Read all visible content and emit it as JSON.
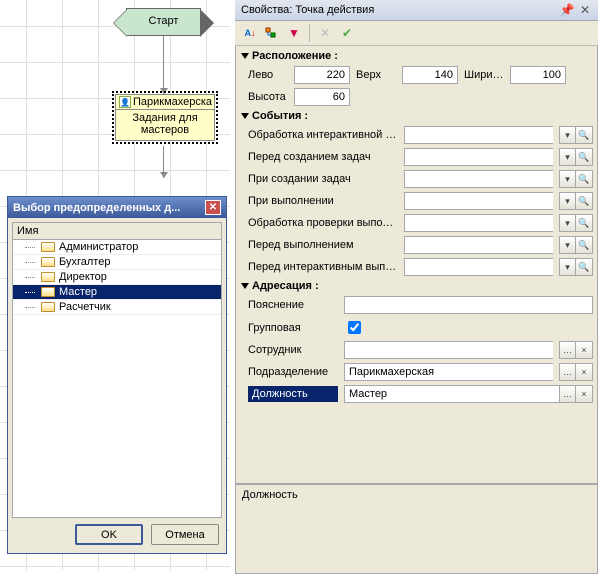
{
  "flowchart": {
    "start_label": "Старт",
    "action_header": "Парикмахерска",
    "action_body_line1": "Задания для",
    "action_body_line2": "мастеров"
  },
  "dialog": {
    "title": "Выбор предопределенных д...",
    "column": "Имя",
    "items": [
      {
        "label": "Администратор",
        "selected": false
      },
      {
        "label": "Бухгалтер",
        "selected": false
      },
      {
        "label": "Директор",
        "selected": false
      },
      {
        "label": "Мастер",
        "selected": true
      },
      {
        "label": "Расчетчик",
        "selected": false
      }
    ],
    "ok_label": "OK",
    "cancel_label": "Отмена"
  },
  "props": {
    "title": "Свойства: Точка действия",
    "sections": {
      "location": "Расположение",
      "events": "События",
      "addressing": "Адресация"
    },
    "location": {
      "left_label": "Лево",
      "left": "220",
      "top_label": "Верх",
      "top": "140",
      "width_label": "Ширина",
      "width": "100",
      "height_label": "Высота",
      "height": "60"
    },
    "events": [
      "Обработка интерактивной акти",
      "Перед созданием задач",
      "При создании задач",
      "При выполнении",
      "Обработка проверки выполнен",
      "Перед выполнением",
      "Перед интерактивным выполне"
    ],
    "addr": {
      "hint_label": "Пояснение",
      "hint_value": "",
      "group_label": "Групповая",
      "group_checked": true,
      "employee_label": "Сотрудник",
      "employee_value": "",
      "department_label": "Подразделение",
      "department_value": "Парикмахерская",
      "position_label": "Должность",
      "position_value": "Мастер"
    },
    "desc_label": "Должность"
  }
}
